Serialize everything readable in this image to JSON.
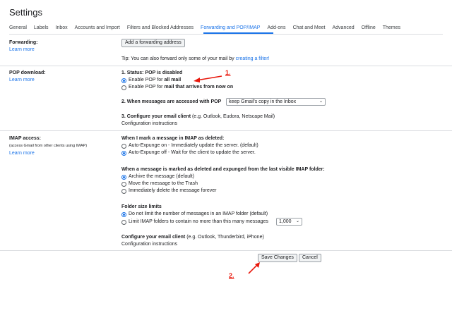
{
  "page_title": "Settings",
  "tabs": [
    {
      "label": "General"
    },
    {
      "label": "Labels"
    },
    {
      "label": "Inbox"
    },
    {
      "label": "Accounts and Import"
    },
    {
      "label": "Filters and Blocked Addresses"
    },
    {
      "label": "Forwarding and POP/IMAP"
    },
    {
      "label": "Add-ons"
    },
    {
      "label": "Chat and Meet"
    },
    {
      "label": "Advanced"
    },
    {
      "label": "Offline"
    },
    {
      "label": "Themes"
    }
  ],
  "active_tab": "Forwarding and POP/IMAP",
  "forwarding": {
    "label": "Forwarding:",
    "learn_more": "Learn more",
    "add_button": "Add a forwarding address",
    "tip_prefix": "Tip: You can also forward only some of your mail by ",
    "tip_link": "creating a filter!"
  },
  "pop": {
    "label": "POP download:",
    "learn_more": "Learn more",
    "status": "1. Status: POP is disabled",
    "option1_prefix": "Enable POP for ",
    "option1_bold": "all mail",
    "option2_prefix": "Enable POP for ",
    "option2_bold": "mail that arrives from now on",
    "when_accessed_label": "2. When messages are accessed with POP",
    "when_accessed_value": "keep Gmail's copy in the Inbox",
    "configure_bold": "3. Configure your email client",
    "configure_rest": " (e.g. Outlook, Eudora, Netscape Mail)",
    "config_link": "Configuration instructions"
  },
  "imap": {
    "label": "IMAP access:",
    "sub": "(access Gmail from other clients using IMAP)",
    "learn_more": "Learn more",
    "deleted_heading": "When I mark a message in IMAP as deleted:",
    "expunge_on": "Auto-Expunge on - Immediately update the server. (default)",
    "expunge_off": "Auto-Expunge off - Wait for the client to update the server.",
    "expunged_heading": "When a message is marked as deleted and expunged from the last visible IMAP folder:",
    "archive": "Archive the message (default)",
    "trash": "Move the message to the Trash",
    "delete_forever": "Immediately delete the message forever",
    "folder_heading": "Folder size limits",
    "no_limit": "Do not limit the number of messages in an IMAP folder (default)",
    "limit": "Limit IMAP folders to contain no more than this many messages",
    "limit_value": "1,000",
    "configure_bold": "Configure your email client",
    "configure_rest": " (e.g. Outlook, Thunderbird, iPhone)",
    "config_link": "Configuration instructions"
  },
  "actions": {
    "save": "Save Changes",
    "cancel": "Cancel"
  },
  "annotations": {
    "step1": "1.",
    "step2": "2.",
    "color": "#e8170b"
  },
  "colors": {
    "link": "#1a73e8",
    "divider": "#dadce0",
    "text": "#202124"
  }
}
